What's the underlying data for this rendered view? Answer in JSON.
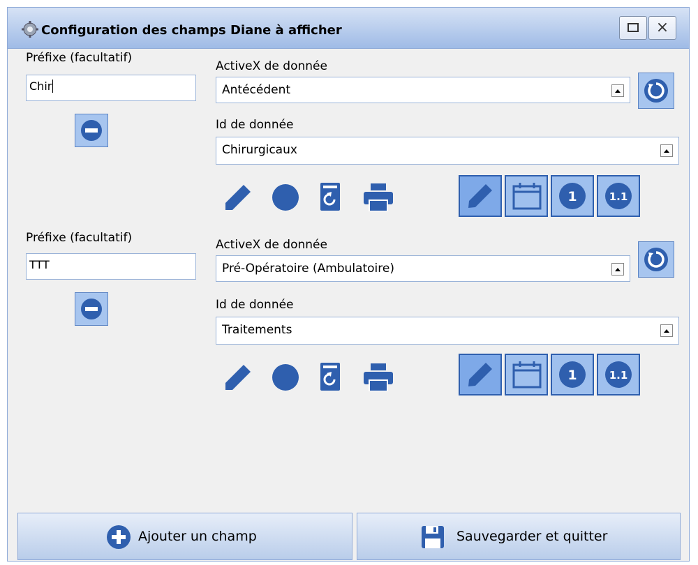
{
  "window": {
    "title": "Configuration des champs Diane à afficher",
    "maximize_icon": "maximize-icon",
    "close_label": "×"
  },
  "fields": [
    {
      "prefix_label": "Préfixe (facultatif)",
      "prefix_value": "Chir",
      "activex_label": "ActiveX de donnée",
      "activex_value": "Antécédent",
      "id_label": "Id de donnée",
      "id_value": "Chirurgicaux"
    },
    {
      "prefix_label": "Préfixe (facultatif)",
      "prefix_value": "TTT",
      "activex_label": "ActiveX de donnée",
      "activex_value": "Pré-Opératoire (Ambulatoire)",
      "id_label": "Id de donnée",
      "id_value": "Traitements"
    }
  ],
  "format_buttons": {
    "one_label": "1",
    "decimal_label": "1.1"
  },
  "footer": {
    "add_label": "Ajouter un champ",
    "save_label": "Sauvegarder et quitter"
  },
  "colors": {
    "accent": "#2f5fae",
    "button_fill": "#9fc0ee",
    "icon_blue": "#2f5fae"
  }
}
